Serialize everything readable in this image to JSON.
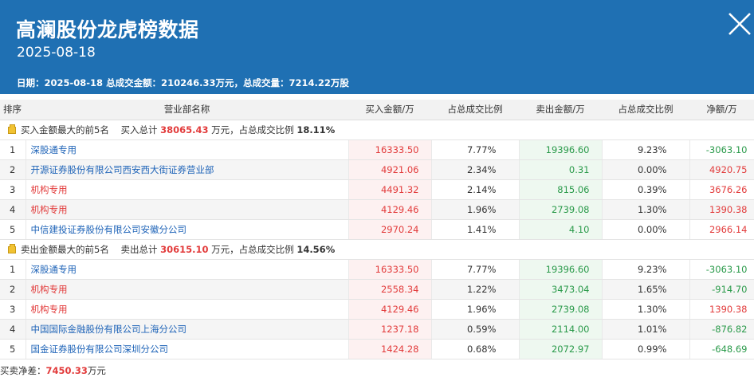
{
  "header": {
    "title": "高澜股份龙虎榜数据",
    "date": "2025-08-18",
    "summary": "日期：2025-08-18 总成交金额：210246.33万元，总成交量：7214.22万股"
  },
  "columns": [
    "排序",
    "营业部名称",
    "买入金额/万",
    "占总成交比例",
    "卖出金额/万",
    "占总成交比例",
    "净额/万"
  ],
  "buy_group": {
    "label": "买入金额最大的前5名",
    "total_prefix": "买入总计",
    "total_value": "38065.43",
    "total_mid": "万元，占总成交比例",
    "total_pct": "18.11%",
    "rows": [
      {
        "rank": "1",
        "name": "深股通专用",
        "buy": "16333.50",
        "buy_pct": "7.77%",
        "sell": "19396.60",
        "sell_pct": "9.23%",
        "net": "-3063.10",
        "name_color": "blue"
      },
      {
        "rank": "2",
        "name": "开源证券股份有限公司西安西大街证券营业部",
        "buy": "4921.06",
        "buy_pct": "2.34%",
        "sell": "0.31",
        "sell_pct": "0.00%",
        "net": "4920.75",
        "name_color": "blue"
      },
      {
        "rank": "3",
        "name": "机构专用",
        "buy": "4491.32",
        "buy_pct": "2.14%",
        "sell": "815.06",
        "sell_pct": "0.39%",
        "net": "3676.26",
        "name_color": "red"
      },
      {
        "rank": "4",
        "name": "机构专用",
        "buy": "4129.46",
        "buy_pct": "1.96%",
        "sell": "2739.08",
        "sell_pct": "1.30%",
        "net": "1390.38",
        "name_color": "red"
      },
      {
        "rank": "5",
        "name": "中信建投证券股份有限公司安徽分公司",
        "buy": "2970.24",
        "buy_pct": "1.41%",
        "sell": "4.10",
        "sell_pct": "0.00%",
        "net": "2966.14",
        "name_color": "blue"
      }
    ]
  },
  "sell_group": {
    "label": "卖出金额最大的前5名",
    "total_prefix": "卖出总计",
    "total_value": "30615.10",
    "total_mid": "万元，占总成交比例",
    "total_pct": "14.56%",
    "rows": [
      {
        "rank": "1",
        "name": "深股通专用",
        "buy": "16333.50",
        "buy_pct": "7.77%",
        "sell": "19396.60",
        "sell_pct": "9.23%",
        "net": "-3063.10",
        "name_color": "blue"
      },
      {
        "rank": "2",
        "name": "机构专用",
        "buy": "2558.34",
        "buy_pct": "1.22%",
        "sell": "3473.04",
        "sell_pct": "1.65%",
        "net": "-914.70",
        "name_color": "red"
      },
      {
        "rank": "3",
        "name": "机构专用",
        "buy": "4129.46",
        "buy_pct": "1.96%",
        "sell": "2739.08",
        "sell_pct": "1.30%",
        "net": "1390.38",
        "name_color": "red"
      },
      {
        "rank": "4",
        "name": "中国国际金融股份有限公司上海分公司",
        "buy": "1237.18",
        "buy_pct": "0.59%",
        "sell": "2114.00",
        "sell_pct": "1.01%",
        "net": "-876.82",
        "name_color": "blue"
      },
      {
        "rank": "5",
        "name": "国金证券股份有限公司深圳分公司",
        "buy": "1424.28",
        "buy_pct": "0.68%",
        "sell": "2072.97",
        "sell_pct": "0.99%",
        "net": "-648.69",
        "name_color": "blue"
      }
    ]
  },
  "footer": {
    "label": "买卖净差：",
    "value": "7450.33",
    "unit": "万元"
  },
  "colors": {
    "header_bg": "#1f70b3",
    "red": "#e23b3b",
    "green": "#2a9a4a",
    "blue": "#1f64b8"
  },
  "icons": {
    "close": "close-icon",
    "group": "folder-icon"
  }
}
